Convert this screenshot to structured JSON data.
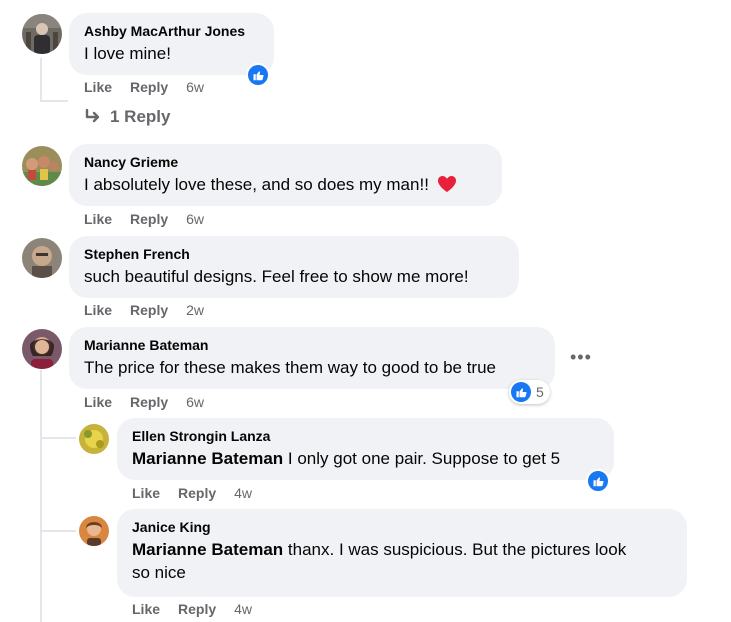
{
  "labels": {
    "like": "Like",
    "reply": "Reply"
  },
  "colors": {
    "like_blue": "#1877f2",
    "heart_red": "#f02849",
    "meta_gray": "#65676b",
    "bubble_bg": "#f0f2f5"
  },
  "comments": [
    {
      "author": "Ashby MacArthur Jones",
      "text": "I love mine!",
      "time": "6w",
      "reaction": "like"
    },
    {
      "author": "Nancy Grieme",
      "text": "I absolutely love these, and so does my man!!",
      "emoji": "heart-emoji",
      "time": "6w"
    },
    {
      "author": "Stephen French",
      "text": "such beautiful designs. Feel free to show me more!",
      "time": "2w"
    },
    {
      "author": "Marianne Bateman",
      "text": "The price for these makes them way to good to be true",
      "time": "6w",
      "reaction": "like",
      "reaction_count": "5"
    }
  ],
  "view_replies": "1 Reply",
  "replies": [
    {
      "author": "Ellen Strongin Lanza",
      "mention": "Marianne Bateman",
      "text": "I only got one pair. Suppose to get 5",
      "time": "4w",
      "reaction": "like"
    },
    {
      "author": "Janice King",
      "mention": "Marianne Bateman",
      "text_line1": "thanx. I was suspicious. But the pictures look",
      "text_line2": "so nice",
      "time": "4w"
    }
  ]
}
